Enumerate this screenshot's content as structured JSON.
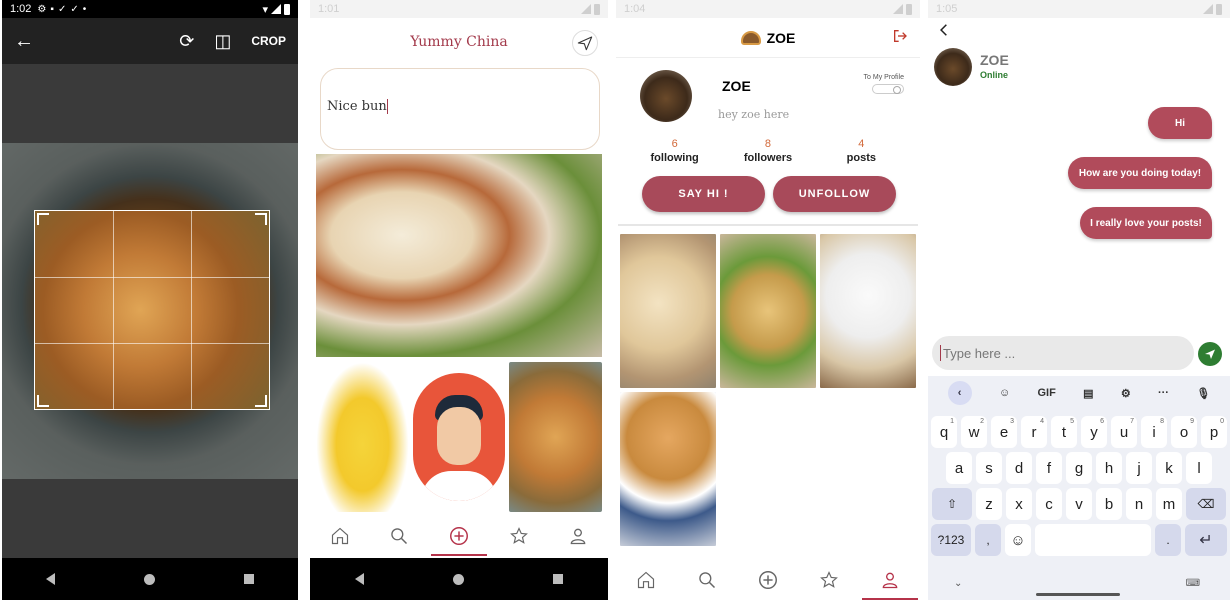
{
  "crop_screen": {
    "status": {
      "time": "1:02"
    },
    "toolbar": {
      "crop_label": "CROP"
    }
  },
  "post_screen": {
    "status": {
      "time": "1:01"
    },
    "title": "Yummy China",
    "caption_value": "Nice bun"
  },
  "profile_screen": {
    "status": {
      "time": "1:04"
    },
    "header_title": "ZOE",
    "name": "ZOE",
    "bio": "hey zoe here",
    "toggle_label": "To My Profile",
    "stats": [
      {
        "value": "6",
        "label": "following"
      },
      {
        "value": "8",
        "label": "followers"
      },
      {
        "value": "4",
        "label": "posts"
      }
    ],
    "buttons": {
      "say_hi": "SAY HI !",
      "unfollow": "UNFOLLOW"
    }
  },
  "chat_screen": {
    "status": {
      "time": "1:05"
    },
    "contact_name": "ZOE",
    "contact_status": "Online",
    "messages": [
      {
        "text": "Hi"
      },
      {
        "text": "How are you doing today!"
      },
      {
        "text": "I really love your posts!"
      }
    ],
    "input_placeholder": "Type here ...",
    "keyboard": {
      "toolbar": {
        "gif": "GIF",
        "more": "···"
      },
      "row1": [
        "q",
        "w",
        "e",
        "r",
        "t",
        "y",
        "u",
        "i",
        "o",
        "p"
      ],
      "row1_hints": [
        "1",
        "2",
        "3",
        "4",
        "5",
        "6",
        "7",
        "8",
        "9",
        "0"
      ],
      "row2": [
        "a",
        "s",
        "d",
        "f",
        "g",
        "h",
        "j",
        "k",
        "l"
      ],
      "row3": [
        "z",
        "x",
        "c",
        "v",
        "b",
        "n",
        "m"
      ],
      "symbols_key": "?123",
      "comma": ",",
      "period": "."
    }
  }
}
